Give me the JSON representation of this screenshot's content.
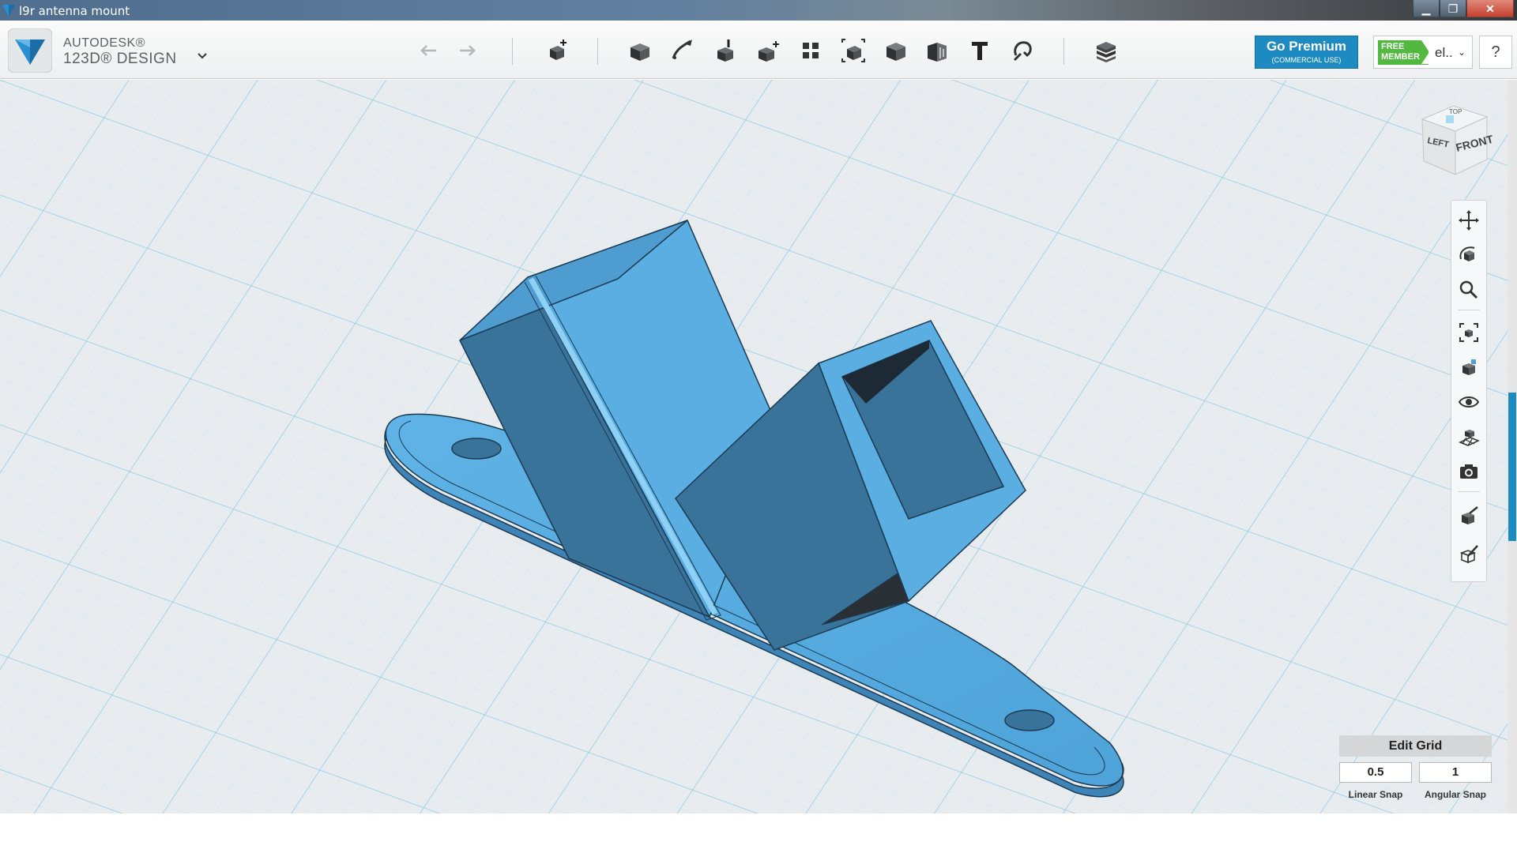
{
  "window": {
    "title": "l9r antenna mount"
  },
  "brand": {
    "line1": "AUTODESK®",
    "line2": "123D® DESIGN"
  },
  "toolbar": {
    "tools": [
      "undo",
      "redo",
      "transform",
      "primitives",
      "sketch",
      "construct",
      "modify",
      "pattern",
      "grouping",
      "combine",
      "measure",
      "text",
      "snap",
      "materials"
    ]
  },
  "premium": {
    "label": "Go Premium",
    "sub": "(COMMERCIAL USE)"
  },
  "account": {
    "badge_line1": "FREE",
    "badge_line2": "MEMBER",
    "user": "el.."
  },
  "help": {
    "label": "?"
  },
  "viewcube": {
    "top": "TOP",
    "left": "LEFT",
    "front": "FRONT"
  },
  "navbar": {
    "tools": [
      "pan",
      "orbit",
      "zoom",
      "fit",
      "view-selected",
      "visibility",
      "grid",
      "screenshot",
      "material",
      "settings"
    ]
  },
  "edit_grid": {
    "title": "Edit Grid",
    "linear_snap_value": "0.5",
    "angular_snap_value": "1",
    "linear_snap_label": "Linear Snap",
    "angular_snap_label": "Angular Snap"
  },
  "colors": {
    "model": "#5aaee2",
    "model_shade": "#3a7399",
    "accent": "#1d8ac2",
    "grid_line": "#a8d7eb",
    "viewport_bg": "#e9ecee"
  }
}
